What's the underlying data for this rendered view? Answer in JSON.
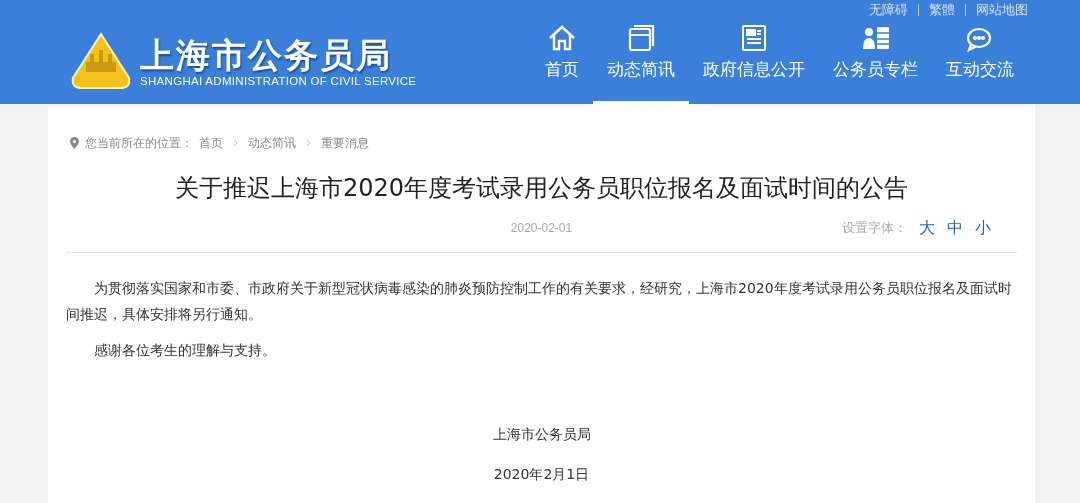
{
  "header": {
    "logo_title": "上海市公务员局",
    "logo_subtitle": "SHANGHAI ADMINISTRATION OF CIVIL SERVICE",
    "top_links": [
      "无障碍",
      "繁體",
      "网站地图"
    ],
    "nav": [
      {
        "label": "首页",
        "kind": "home",
        "selected": false
      },
      {
        "label": "动态简讯",
        "kind": "window",
        "selected": true
      },
      {
        "label": "政府信息公开",
        "kind": "newspaper",
        "selected": false
      },
      {
        "label": "公务员专栏",
        "kind": "people",
        "selected": false
      },
      {
        "label": "互动交流",
        "kind": "chat",
        "selected": false
      }
    ]
  },
  "breadcrumb": {
    "prefix": "您当前所在的位置：",
    "items": [
      "首页",
      "动态简讯",
      "重要消息"
    ]
  },
  "article": {
    "title": "关于推迟上海市2020年度考试录用公务员职位报名及面试时间的公告",
    "date": "2020-02-01",
    "font_label": "设置字体：",
    "font_sizes": [
      "大",
      "中",
      "小"
    ],
    "paragraphs": [
      "为贯彻落实国家和市委、市政府关于新型冠状病毒感染的肺炎预防控制工作的有关要求，经研究，上海市2020年度考试录用公务员职位报名及面试时间推迟，具体安排将另行通知。",
      "感谢各位考生的理解与支持。"
    ],
    "signature": "上海市公务员局",
    "signature_date": "2020年2月1日"
  }
}
